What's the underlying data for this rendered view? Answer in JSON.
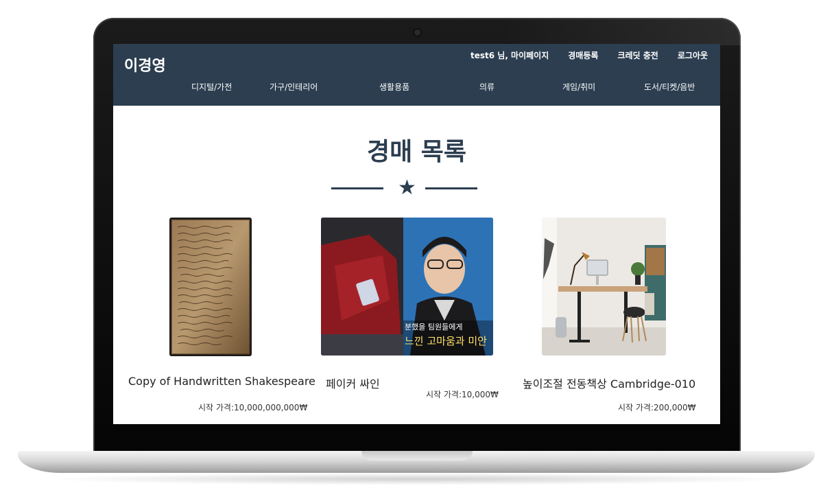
{
  "site": {
    "brand": "이경영",
    "user_nav": [
      "test6 님, 마이페이지",
      "경매등록",
      "크레딧 충전",
      "로그아웃"
    ],
    "categories": [
      "디지털/가전",
      "가구/인테리어",
      "생활용품",
      "의류",
      "게임/취미",
      "도서/티켓/음반"
    ]
  },
  "main": {
    "title": "경매 목록",
    "items": [
      {
        "title": "Copy of Handwritten Shakespeare",
        "price": "시작 가격:10,000,000,000₩",
        "image": "handwritten-manuscript-photo"
      },
      {
        "title": "페이커 싸인",
        "price": "시작 가격:10,000₩",
        "image": "tv-show-screenshot",
        "image_caption_line1": "분했을 팀원들에게",
        "image_caption_line2": "느낀 고마움과 미안"
      },
      {
        "title": "높이조절 전동책상 Cambridge-010",
        "price": "시작 가격:200,000₩",
        "image": "office-desk-photo"
      }
    ]
  },
  "colors": {
    "header_bg": "#2c3e50",
    "accent": "#2c3e50",
    "screen_bg": "#ffffff"
  }
}
